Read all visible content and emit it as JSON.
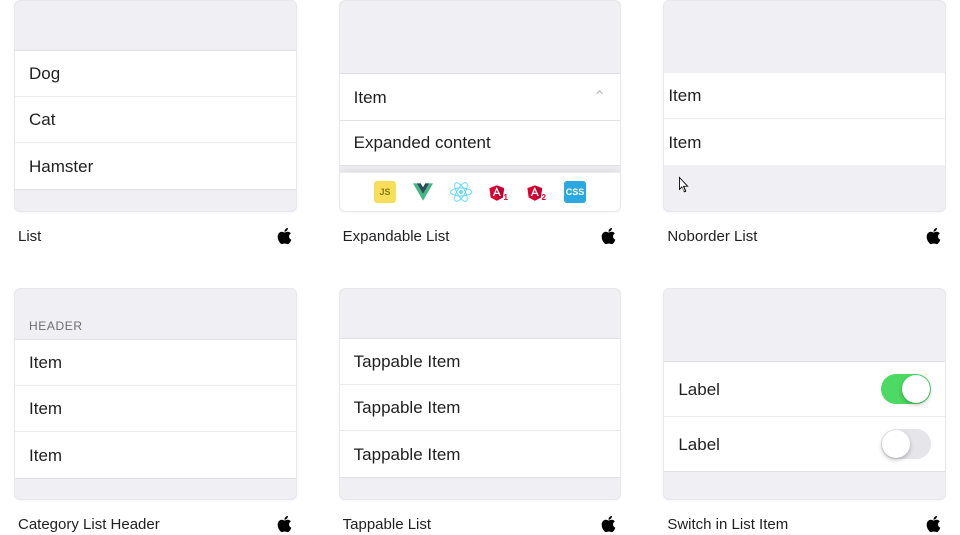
{
  "tiles": {
    "list": {
      "items": [
        "Dog",
        "Cat",
        "Hamster"
      ],
      "caption": "List"
    },
    "expandable": {
      "item_label": "Item",
      "expanded_content": "Expanded content",
      "caption": "Expandable List",
      "framework_icons": [
        "js",
        "vue",
        "react",
        "angular1",
        "angular2",
        "css"
      ]
    },
    "noborder": {
      "items": [
        "Item",
        "Item"
      ],
      "caption": "Noborder List"
    },
    "category": {
      "header": "HEADER",
      "items": [
        "Item",
        "Item",
        "Item"
      ],
      "caption": "Category List Header"
    },
    "tappable": {
      "items": [
        "Tappable Item",
        "Tappable Item",
        "Tappable Item"
      ],
      "caption": "Tappable List"
    },
    "switch": {
      "rows": [
        {
          "label": "Label",
          "on": true
        },
        {
          "label": "Label",
          "on": false
        }
      ],
      "caption": "Switch in List Item"
    }
  },
  "icons": {
    "js_label": "JS",
    "css_label": "CSS",
    "angular1_sub": "1",
    "angular2_sub": "2"
  }
}
